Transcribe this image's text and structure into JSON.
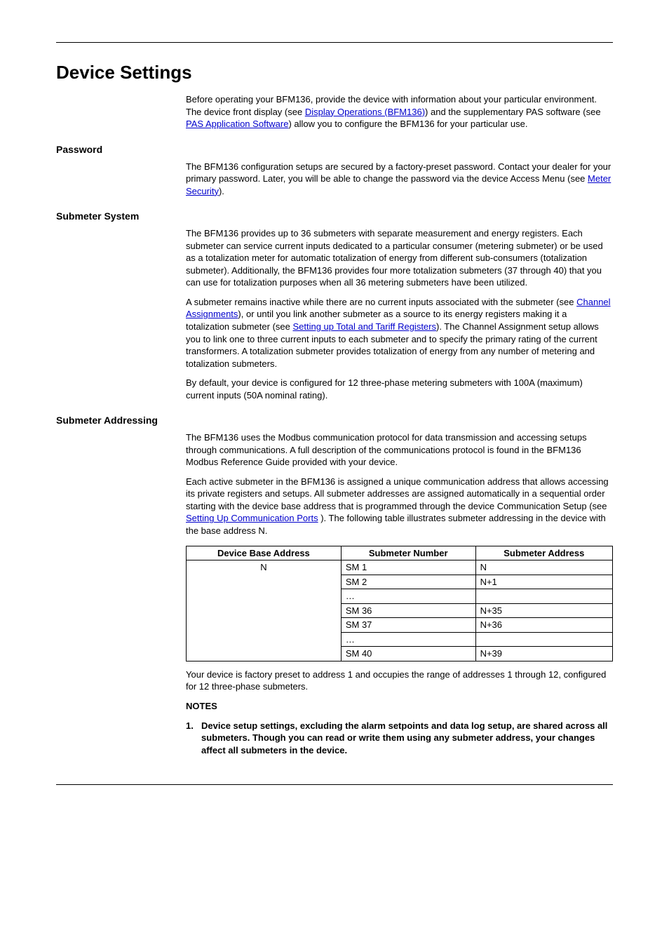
{
  "title": "Device Settings",
  "intro": {
    "before": "Before operating your BFM136, provide the device with information about your particular environment. The device front display (see ",
    "link1": "Display Operations (BFM136)",
    "mid1": ") and the supplementary PAS software (see ",
    "link2": "PAS Application Software",
    "after": ") allow you to configure the BFM136 for your particular use."
  },
  "password": {
    "heading": "Password",
    "before": "The BFM136 configuration setups are secured by a factory-preset password. Contact your dealer for your primary password. Later, you will be able to change the password via the device Access Menu (see ",
    "link": "Meter Security",
    "after": ")."
  },
  "submeter_system": {
    "heading": "Submeter System",
    "p1": "The BFM136 provides up to 36 submeters with separate measurement and energy registers. Each submeter can service current inputs dedicated to a particular consumer (metering submeter) or be used as a totalization meter for automatic totalization of energy from different sub-consumers (totalization submeter). Additionally, the BFM136 provides four more totalization submeters (37 through 40) that you can use for totalization purposes when all 36 metering submeters have been utilized.",
    "p2_a": "A submeter remains inactive while there are no current inputs associated with the submeter (see ",
    "p2_link1": "Channel Assignments",
    "p2_b": "), or until you link another submeter as a source to its energy registers making it a totalization submeter (see ",
    "p2_link2": "Setting up Total and Tariff Registers",
    "p2_c": "). The Channel Assignment setup allows you to link one to three current inputs to each submeter and to specify the primary rating of the current transformers. A totalization submeter provides totalization of energy from any number of metering and totalization submeters.",
    "p3": "By default, your device is configured for 12 three-phase metering submeters with 100A (maximum) current inputs (50A nominal rating)."
  },
  "addressing": {
    "heading": "Submeter Addressing",
    "p1": "The BFM136 uses the Modbus communication protocol for data transmission and accessing setups through communications. A full description of the communications protocol is found in the BFM136  Modbus Reference Guide provided with your device.",
    "p2_a": "Each active submeter in the BFM136  is assigned a unique communication address that allows accessing its private registers and setups. All submeter addresses are assigned automatically in a sequential order starting with the device base address that is programmed through the device Communication Setup (see ",
    "p2_link": "Setting Up Communication Ports",
    "p2_b": " ). The following table illustrates submeter addressing in the device with the base address N.",
    "table": {
      "headers": [
        "Device Base Address",
        "Submeter Number",
        "Submeter Address"
      ],
      "rows": [
        [
          "N",
          "SM 1",
          "N"
        ],
        [
          "",
          "SM 2",
          "N+1"
        ],
        [
          "",
          "…",
          ""
        ],
        [
          "",
          "SM 36",
          "N+35"
        ],
        [
          "",
          "SM 37",
          "N+36"
        ],
        [
          "",
          "…",
          ""
        ],
        [
          "",
          "SM 40",
          "N+39"
        ]
      ]
    },
    "p3": "Your device is factory preset to address 1 and occupies the range of addresses 1 through 12, configured for 12 three-phase submeters.",
    "notes_label": "NOTES",
    "note1_num": "1.",
    "note1": "Device setup settings, excluding the alarm setpoints and data log setup, are shared across all submeters. Though you can read or write them using any submeter address, your changes affect all submeters in the device."
  }
}
